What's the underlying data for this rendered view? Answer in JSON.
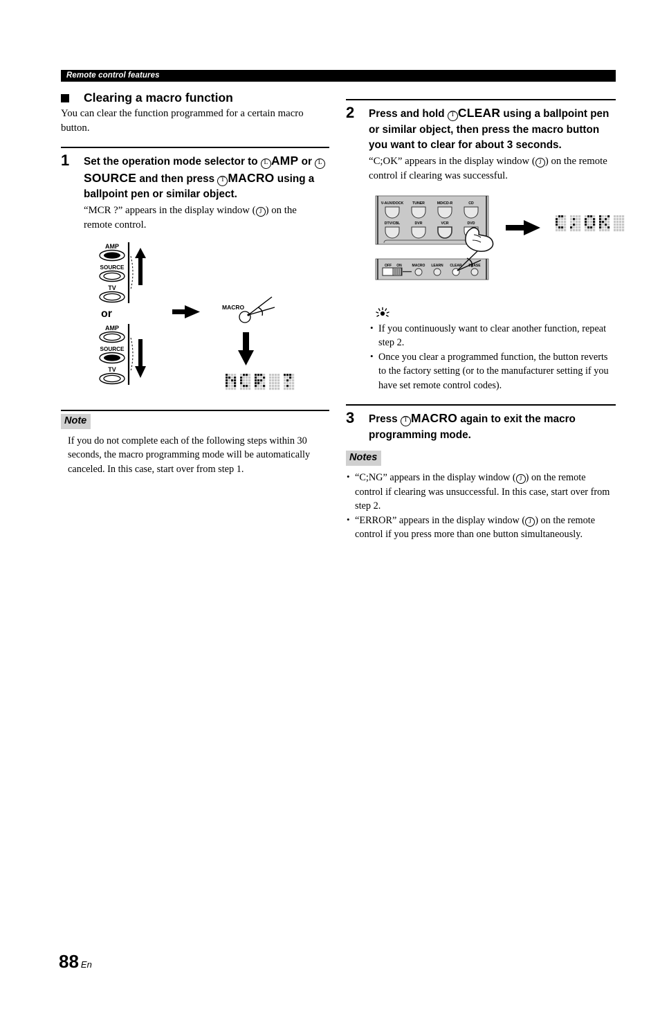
{
  "header": {
    "running_head": "Remote control features"
  },
  "section": {
    "heading": "Clearing a macro function",
    "intro": "You can clear the function programmed for a certain macro button."
  },
  "steps": [
    {
      "number": "1",
      "title_parts": {
        "a": "Set the operation mode selector to ",
        "circle1": "L",
        "b": "AMP",
        "c": " or ",
        "circle2": "L",
        "d": "SOURCE",
        "e": " and then press ",
        "circle3": "T",
        "f": "MACRO",
        "g": " using a ballpoint pen or similar object."
      },
      "desc_a": "“MCR ?” appears in the display window (",
      "desc_circle": "J",
      "desc_b": ") on the remote control."
    },
    {
      "number": "2",
      "title_parts": {
        "a": "Press and hold ",
        "circle1": "T",
        "b": "CLEAR",
        "c": " using a ballpoint pen or similar object, then press the macro button you want to clear for about 3 seconds."
      },
      "desc_a": "“C;OK” appears in the display window (",
      "desc_circle": "J",
      "desc_b": ") on the remote control if clearing was successful."
    },
    {
      "number": "3",
      "title_parts": {
        "a": "Press ",
        "circle1": "T",
        "b": "MACRO",
        "c": " again to exit the macro programming mode."
      }
    }
  ],
  "note_left": {
    "label": "Note",
    "body": "If you do not complete each of the following steps within 30 seconds, the macro programming mode will be automatically canceled. In this case, start over from step 1."
  },
  "tip_right": {
    "icon": "tip-sun-icon",
    "bullets": [
      "If you continuously want to clear another function, repeat step 2.",
      "Once you clear a programmed function, the button reverts to the factory setting (or to the manufacturer setting if you have set remote control codes)."
    ]
  },
  "notes_right": {
    "label": "Notes",
    "bullets": [
      {
        "a": "“C;NG” appears in the display window (",
        "circle": "J",
        "b": ") on the remote control if clearing was unsuccessful. In this case, start over from step 2."
      },
      {
        "a": "“ERROR” appears in the display window (",
        "circle": "J",
        "b": ") on the remote control if you press more than one button simultaneously."
      }
    ]
  },
  "figure_step1": {
    "selector_top": {
      "labels": [
        "AMP",
        "SOURCE",
        "TV"
      ],
      "selected": "AMP",
      "arrow_direction": "up"
    },
    "or_label": "or",
    "selector_bottom": {
      "labels": [
        "AMP",
        "SOURCE",
        "TV"
      ],
      "selected": "SOURCE",
      "arrow_direction": "down"
    },
    "pen_button_label": "MACRO",
    "display_text": "MCR ?"
  },
  "figure_step2": {
    "source_buttons_row1": [
      "V-AUX/DOCK",
      "TUNER",
      "MD/CD-R",
      "CD"
    ],
    "source_buttons_row2": [
      "DTV/CBL",
      "DVR",
      "VCR",
      "DVD"
    ],
    "pressed_button": "DVD",
    "switch_labels": [
      "OFF",
      "ON"
    ],
    "pin_labels": [
      "MACRO",
      "LEARN",
      "CLEAR",
      "ERASE"
    ],
    "pressed_pin": "CLEAR",
    "display_text": "C;OK"
  },
  "footer": {
    "page_number": "88",
    "language": "En"
  },
  "colors": {
    "panel_gray": "#c9c9c9",
    "button_gray": "#e8e8e8",
    "note_label_bg": "#d0d0d0",
    "ink": "#000000"
  }
}
